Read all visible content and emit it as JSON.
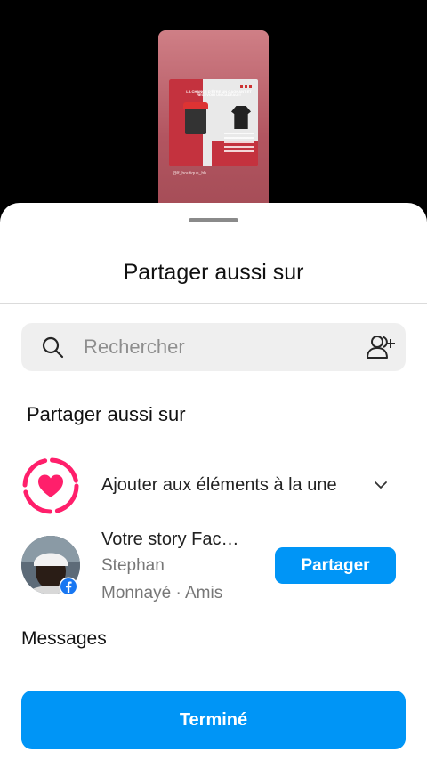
{
  "story_preview": {
    "card_title": "LA CHANCE D'ÊTRE UN GAGNANT ET RECEVOIR UN CADEAU !!",
    "handle": "@lf_boutique_bb"
  },
  "sheet": {
    "title": "Partager aussi sur"
  },
  "search": {
    "placeholder": "Rechercher",
    "value": ""
  },
  "share_section": {
    "heading": "Partager aussi sur",
    "highlight": {
      "label": "Ajouter aux éléments à la une",
      "icon": "heart-ring-icon",
      "accent": "#ff1f6b"
    },
    "facebook": {
      "title": "Votre story Fac…",
      "name": "Stephan",
      "meta": "Monnayé · Amis",
      "button": "Partager",
      "badge_icon": "facebook-icon"
    }
  },
  "messages": {
    "heading": "Messages"
  },
  "footer": {
    "done_label": "Terminé"
  },
  "colors": {
    "primary": "#0095f6",
    "highlight": "#ff1f6b",
    "search_bg": "#efefef"
  }
}
